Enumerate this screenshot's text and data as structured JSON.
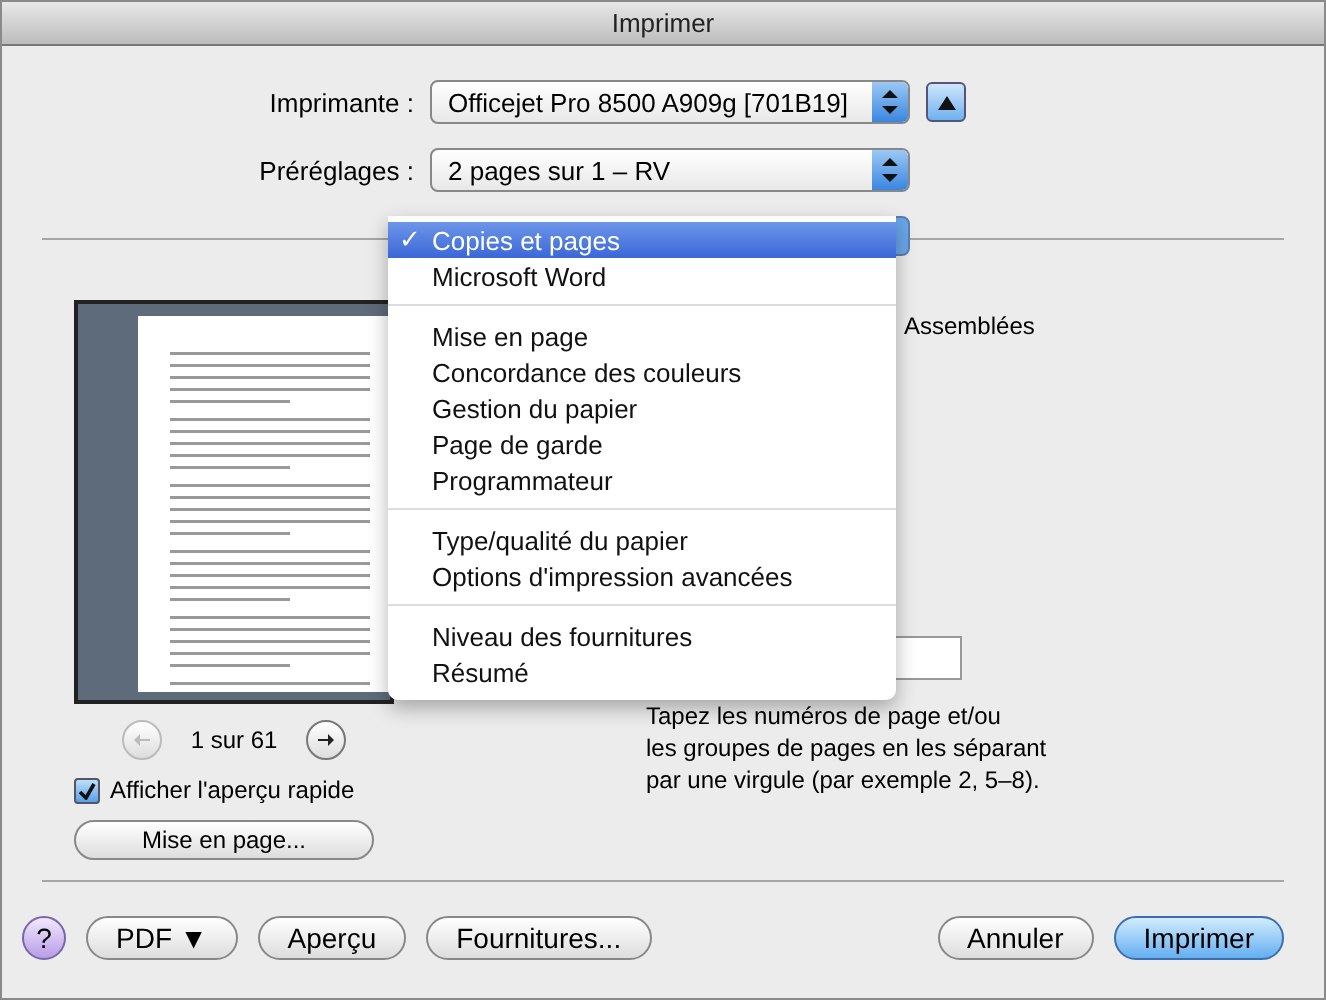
{
  "window": {
    "title": "Imprimer"
  },
  "printer": {
    "label": "Imprimante :",
    "value": "Officejet Pro 8500 A909g [701B19]"
  },
  "presets": {
    "label": "Préréglages :",
    "value": "2 pages sur 1 – RV"
  },
  "pager": {
    "indicator": "1 sur 61",
    "prev_disabled": true,
    "next_disabled": false
  },
  "quick_preview": {
    "label": "Afficher l'aperçu rapide",
    "checked": true
  },
  "page_setup_button": "Mise en page...",
  "collate": {
    "label": "Assemblées"
  },
  "page_range_hint": "Tapez les numéros de page et/ou\nles groupes de pages en les séparant\npar une virgule (par exemple 2, 5–8).",
  "menu": {
    "check": "✓",
    "groups": [
      [
        {
          "label": "Copies et pages",
          "selected": true
        },
        {
          "label": "Microsoft Word",
          "selected": false
        }
      ],
      [
        {
          "label": "Mise en page",
          "selected": false
        },
        {
          "label": "Concordance des couleurs",
          "selected": false
        },
        {
          "label": "Gestion du papier",
          "selected": false
        },
        {
          "label": "Page de garde",
          "selected": false
        },
        {
          "label": "Programmateur",
          "selected": false
        }
      ],
      [
        {
          "label": "Type/qualité du papier",
          "selected": false
        },
        {
          "label": "Options d'impression avancées",
          "selected": false
        }
      ],
      [
        {
          "label": "Niveau des fournitures",
          "selected": false
        },
        {
          "label": "Résumé",
          "selected": false
        }
      ]
    ]
  },
  "buttons": [
    {
      "label": "?",
      "kind": "help"
    },
    {
      "label": "PDF ▼",
      "kind": "normal"
    },
    {
      "label": "Aperçu",
      "kind": "normal"
    },
    {
      "label": "Fournitures...",
      "kind": "normal"
    },
    {
      "label": "Annuler",
      "kind": "spacer-normal"
    },
    {
      "label": "Imprimer",
      "kind": "default"
    }
  ]
}
